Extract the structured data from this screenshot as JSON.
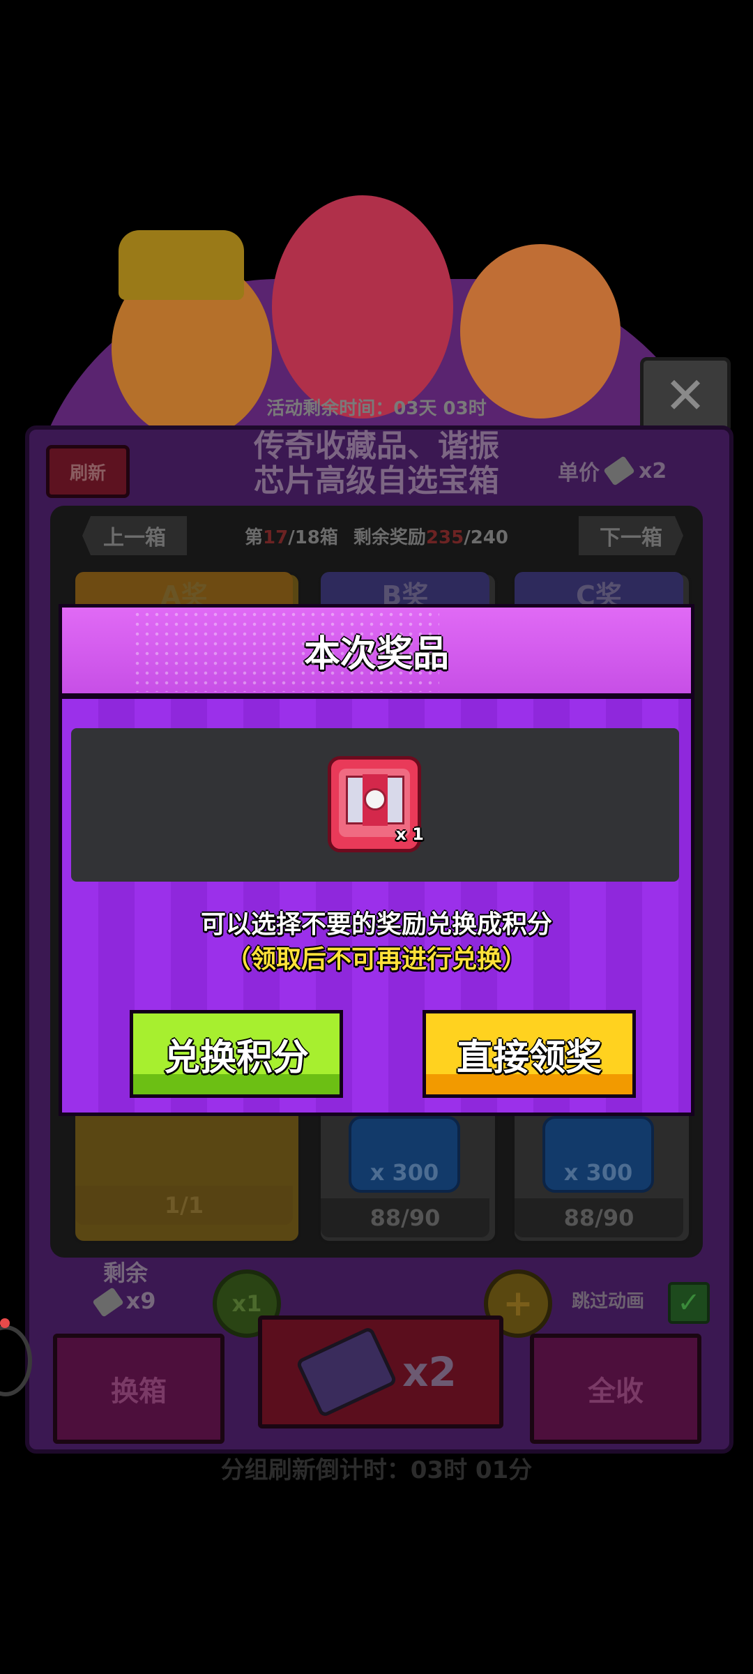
{
  "background": {
    "close_icon": "close-icon",
    "event_timer": "活动剩余时间：03天 03时",
    "refresh_label": "刷新",
    "title_line1": "传奇收藏品、谐振",
    "title_line2": "芯片高级自选宝箱",
    "unit_price_label": "单价",
    "unit_price_value": "x2",
    "prev_box": "上一箱",
    "next_box": "下一箱",
    "box_index_prefix": "第",
    "box_index_current": "17",
    "box_index_suffix": "/18箱",
    "remaining_label": "剩余奖励",
    "remaining_current": "235",
    "remaining_total": "/240",
    "prize_a_label": "A奖",
    "prize_b_label": "B奖",
    "prize_c_label": "C奖",
    "prize_b_amount": "x 300",
    "prize_c_amount": "x 300",
    "prize_a_count": "1/1",
    "prize_b_count": "88/90",
    "prize_c_count": "88/90",
    "remain_label": "剩余",
    "remain_value": "x9",
    "x1_badge": "x1",
    "plus_badge": "+",
    "skip_anim": "跳过动画",
    "check_mark": "✓",
    "swap_box": "换箱",
    "draw_x2": "x2",
    "collect_all": "全收",
    "group_refresh": "分组刷新倒计时：03时 01分"
  },
  "dialog": {
    "title": "本次奖品",
    "reward_qty": "x 1",
    "desc_line1": "可以选择不要的奖励兑换成积分",
    "desc_line2": "（领取后不可再进行兑换）",
    "exchange_button": "兑换积分",
    "claim_button": "直接领奖"
  },
  "colors": {
    "dialog_bg": "#9a2ee8",
    "dialog_header": "#e06af5",
    "exchange_btn": "#a7ef2f",
    "claim_btn": "#ffd21f",
    "note_yellow": "#ffe23a"
  }
}
